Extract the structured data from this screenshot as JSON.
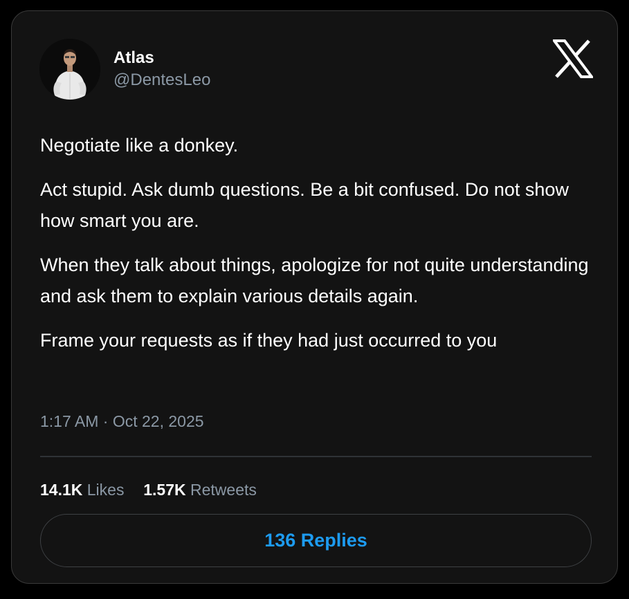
{
  "author": {
    "name": "Atlas",
    "handle": "@DentesLeo",
    "avatar_icon": "user-avatar"
  },
  "brand": {
    "logo_icon": "x-logo-icon"
  },
  "tweet": {
    "paragraphs": [
      "Negotiate like a donkey.",
      "Act stupid. Ask dumb questions. Be a bit confused. Do not show how smart you are.",
      "When they talk about things, apologize for not quite understanding and ask them to explain various details again.",
      "Frame your requests as if they had just occurred to you"
    ],
    "timestamp": "1:17 AM · Oct 22, 2025"
  },
  "stats": {
    "likes_count": "14.1K",
    "likes_label": "Likes",
    "retweets_count": "1.57K",
    "retweets_label": "Retweets"
  },
  "replies_button": {
    "label": "136 Replies"
  },
  "colors": {
    "background": "#000000",
    "card": "#131313",
    "text": "#ffffff",
    "muted": "#8b98a5",
    "accent": "#1d9bf0"
  }
}
